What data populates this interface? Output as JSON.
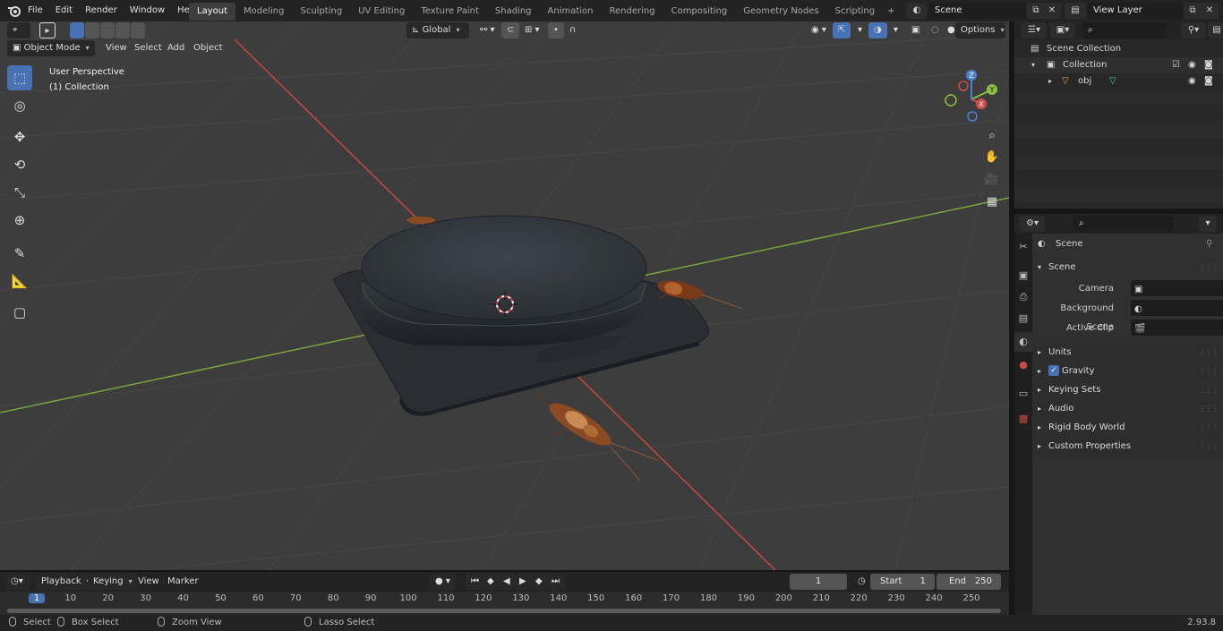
{
  "topbar": {
    "menus": [
      "File",
      "Edit",
      "Render",
      "Window",
      "Help"
    ],
    "workspaces": [
      "Layout",
      "Modeling",
      "Sculpting",
      "UV Editing",
      "Texture Paint",
      "Shading",
      "Animation",
      "Rendering",
      "Compositing",
      "Geometry Nodes",
      "Scripting"
    ],
    "active_workspace": "Layout",
    "scene_name": "Scene",
    "view_layer_name": "View Layer"
  },
  "viewport": {
    "mode": "Object Mode",
    "menus": [
      "View",
      "Select",
      "Add",
      "Object"
    ],
    "transform_orientation": "Global",
    "options_label": "Options",
    "overlay_title": "User Perspective",
    "overlay_collection": "(1) Collection",
    "gizmo_axes": [
      "X",
      "Y",
      "Z"
    ]
  },
  "outliner": {
    "items": [
      {
        "label": "Scene Collection"
      },
      {
        "label": "Collection"
      },
      {
        "label": "obj"
      }
    ]
  },
  "properties": {
    "context_title": "Scene",
    "section": "Scene",
    "fields": [
      {
        "label": "Camera"
      },
      {
        "label": "Background Scene"
      },
      {
        "label": "Active Clip"
      }
    ],
    "panels": [
      "Units",
      "Gravity",
      "Keying Sets",
      "Audio",
      "Rigid Body World",
      "Custom Properties"
    ],
    "gravity_enabled": true
  },
  "timeline": {
    "menus": [
      "Playback",
      "Keying",
      "View",
      "Marker"
    ],
    "current_frame": "1",
    "start_label": "Start",
    "start_value": "1",
    "end_label": "End",
    "end_value": "250",
    "ruler_ticks": [
      "1",
      "10",
      "20",
      "30",
      "40",
      "50",
      "60",
      "70",
      "80",
      "90",
      "100",
      "110",
      "120",
      "130",
      "140",
      "150",
      "160",
      "170",
      "180",
      "190",
      "200",
      "210",
      "220",
      "230",
      "240",
      "250"
    ]
  },
  "statusbar": {
    "select": "Select",
    "box_select": "Box Select",
    "zoom_view": "Zoom View",
    "lasso_select": "Lasso Select",
    "version": "2.93.8"
  },
  "colors": {
    "accent": "#4772b3",
    "x_axis": "#d44b4b",
    "y_axis": "#8bbf3a",
    "z_axis": "#4b82d4"
  }
}
